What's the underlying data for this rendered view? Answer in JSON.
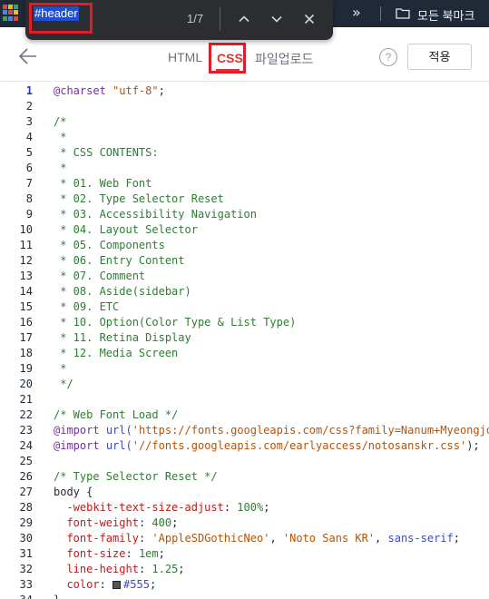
{
  "bookmark_bar": {
    "more_icon": "double-chevron-right",
    "folder_icon": "folder",
    "folder_label": "모든 북마크"
  },
  "find_bar": {
    "query": "#header",
    "match_count": "1/7",
    "buttons": [
      "previous-match",
      "next-match",
      "close"
    ]
  },
  "editor": {
    "back_icon": "arrow-left",
    "tabs": [
      {
        "label": "HTML",
        "active": false
      },
      {
        "label": "CSS",
        "active": true
      },
      {
        "label": "파일업로드",
        "active": false
      }
    ],
    "help_label": "?",
    "apply_label": "적용"
  },
  "code": {
    "active_line": 1,
    "lines": [
      {
        "n": "1",
        "tokens": [
          {
            "t": "@charset",
            "c": "kw"
          },
          {
            "t": " ",
            "c": "plain"
          },
          {
            "t": "\"utf-8\"",
            "c": "str"
          },
          {
            "t": ";",
            "c": "plain"
          }
        ]
      },
      {
        "n": "2",
        "tokens": []
      },
      {
        "n": "3",
        "tokens": [
          {
            "t": "/*",
            "c": "cmt"
          }
        ]
      },
      {
        "n": "4",
        "tokens": [
          {
            "t": " *",
            "c": "cmt"
          }
        ]
      },
      {
        "n": "5",
        "tokens": [
          {
            "t": " * CSS CONTENTS:",
            "c": "cmt"
          }
        ]
      },
      {
        "n": "6",
        "tokens": [
          {
            "t": " *",
            "c": "cmt"
          }
        ]
      },
      {
        "n": "7",
        "tokens": [
          {
            "t": " * 01. Web Font",
            "c": "cmt"
          }
        ]
      },
      {
        "n": "8",
        "tokens": [
          {
            "t": " * 02. Type Selector Reset",
            "c": "cmt"
          }
        ]
      },
      {
        "n": "9",
        "tokens": [
          {
            "t": " * 03. Accessibility Navigation",
            "c": "cmt"
          }
        ]
      },
      {
        "n": "10",
        "tokens": [
          {
            "t": " * 04. Layout Selector",
            "c": "cmt"
          }
        ]
      },
      {
        "n": "11",
        "tokens": [
          {
            "t": " * 05. Components",
            "c": "cmt"
          }
        ]
      },
      {
        "n": "12",
        "tokens": [
          {
            "t": " * 06. Entry Content",
            "c": "cmt"
          }
        ]
      },
      {
        "n": "13",
        "tokens": [
          {
            "t": " * 07. Comment",
            "c": "cmt"
          }
        ]
      },
      {
        "n": "14",
        "tokens": [
          {
            "t": " * 08. Aside(sidebar)",
            "c": "cmt"
          }
        ]
      },
      {
        "n": "15",
        "tokens": [
          {
            "t": " * 09. ETC",
            "c": "cmt"
          }
        ]
      },
      {
        "n": "16",
        "tokens": [
          {
            "t": " * 10. Option(Color Type & List Type)",
            "c": "cmt"
          }
        ]
      },
      {
        "n": "17",
        "tokens": [
          {
            "t": " * 11. Retina Display",
            "c": "cmt"
          }
        ]
      },
      {
        "n": "18",
        "tokens": [
          {
            "t": " * 12. Media Screen",
            "c": "cmt"
          }
        ]
      },
      {
        "n": "19",
        "tokens": [
          {
            "t": " *",
            "c": "cmt"
          }
        ]
      },
      {
        "n": "20",
        "tokens": [
          {
            "t": " */",
            "c": "cmt"
          }
        ]
      },
      {
        "n": "21",
        "tokens": []
      },
      {
        "n": "22",
        "tokens": [
          {
            "t": "/* Web Font Load */",
            "c": "cmt"
          }
        ]
      },
      {
        "n": "23",
        "tokens": [
          {
            "t": "@import",
            "c": "kw"
          },
          {
            "t": " ",
            "c": "plain"
          },
          {
            "t": "url(",
            "c": "fn"
          },
          {
            "t": "'https://fonts.googleapis.com/css?family=Nanum+Myeongjo",
            "c": "str"
          }
        ]
      },
      {
        "n": "24",
        "tokens": [
          {
            "t": "@import",
            "c": "kw"
          },
          {
            "t": " ",
            "c": "plain"
          },
          {
            "t": "url(",
            "c": "fn"
          },
          {
            "t": "'//fonts.googleapis.com/earlyaccess/notosanskr.css'",
            "c": "str"
          },
          {
            "t": ");",
            "c": "plain"
          }
        ]
      },
      {
        "n": "25",
        "tokens": []
      },
      {
        "n": "26",
        "tokens": [
          {
            "t": "/* Type Selector Reset */",
            "c": "cmt"
          }
        ]
      },
      {
        "n": "27",
        "tokens": [
          {
            "t": "body {",
            "c": "plain"
          }
        ]
      },
      {
        "n": "28",
        "tokens": [
          {
            "t": "  ",
            "c": "plain"
          },
          {
            "t": "-webkit-text-size-adjust",
            "c": "prop"
          },
          {
            "t": ": ",
            "c": "plain"
          },
          {
            "t": "100%",
            "c": "num"
          },
          {
            "t": ";",
            "c": "plain"
          }
        ]
      },
      {
        "n": "29",
        "tokens": [
          {
            "t": "  ",
            "c": "plain"
          },
          {
            "t": "font-weight",
            "c": "prop"
          },
          {
            "t": ": ",
            "c": "plain"
          },
          {
            "t": "400",
            "c": "num"
          },
          {
            "t": ";",
            "c": "plain"
          }
        ]
      },
      {
        "n": "30",
        "tokens": [
          {
            "t": "  ",
            "c": "plain"
          },
          {
            "t": "font-family",
            "c": "prop"
          },
          {
            "t": ": ",
            "c": "plain"
          },
          {
            "t": "'AppleSDGothicNeo'",
            "c": "str"
          },
          {
            "t": ", ",
            "c": "plain"
          },
          {
            "t": "'Noto Sans KR'",
            "c": "str"
          },
          {
            "t": ", ",
            "c": "plain"
          },
          {
            "t": "sans-serif",
            "c": "fn"
          },
          {
            "t": ";",
            "c": "plain"
          }
        ]
      },
      {
        "n": "31",
        "tokens": [
          {
            "t": "  ",
            "c": "plain"
          },
          {
            "t": "font-size",
            "c": "prop"
          },
          {
            "t": ": ",
            "c": "plain"
          },
          {
            "t": "1em",
            "c": "num"
          },
          {
            "t": ";",
            "c": "plain"
          }
        ]
      },
      {
        "n": "32",
        "tokens": [
          {
            "t": "  ",
            "c": "plain"
          },
          {
            "t": "line-height",
            "c": "prop"
          },
          {
            "t": ": ",
            "c": "plain"
          },
          {
            "t": "1.25",
            "c": "num"
          },
          {
            "t": ";",
            "c": "plain"
          }
        ]
      },
      {
        "n": "33",
        "tokens": [
          {
            "t": "  ",
            "c": "plain"
          },
          {
            "t": "color",
            "c": "prop"
          },
          {
            "t": ": ",
            "c": "plain"
          },
          {
            "t": "SWATCH",
            "c": "swatch"
          },
          {
            "t": "#555",
            "c": "fn"
          },
          {
            "t": ";",
            "c": "plain"
          }
        ]
      },
      {
        "n": "34",
        "tokens": [
          {
            "t": "}",
            "c": "plain"
          }
        ]
      }
    ]
  },
  "colors": {
    "find_highlight_border": "#e11d2c",
    "active_tab": "#e0332f",
    "comment": "#2e7d32",
    "at_rule": "#7b2aa8",
    "property": "#b91c1c",
    "string": "#b45309",
    "swatch_555": "#555555"
  }
}
